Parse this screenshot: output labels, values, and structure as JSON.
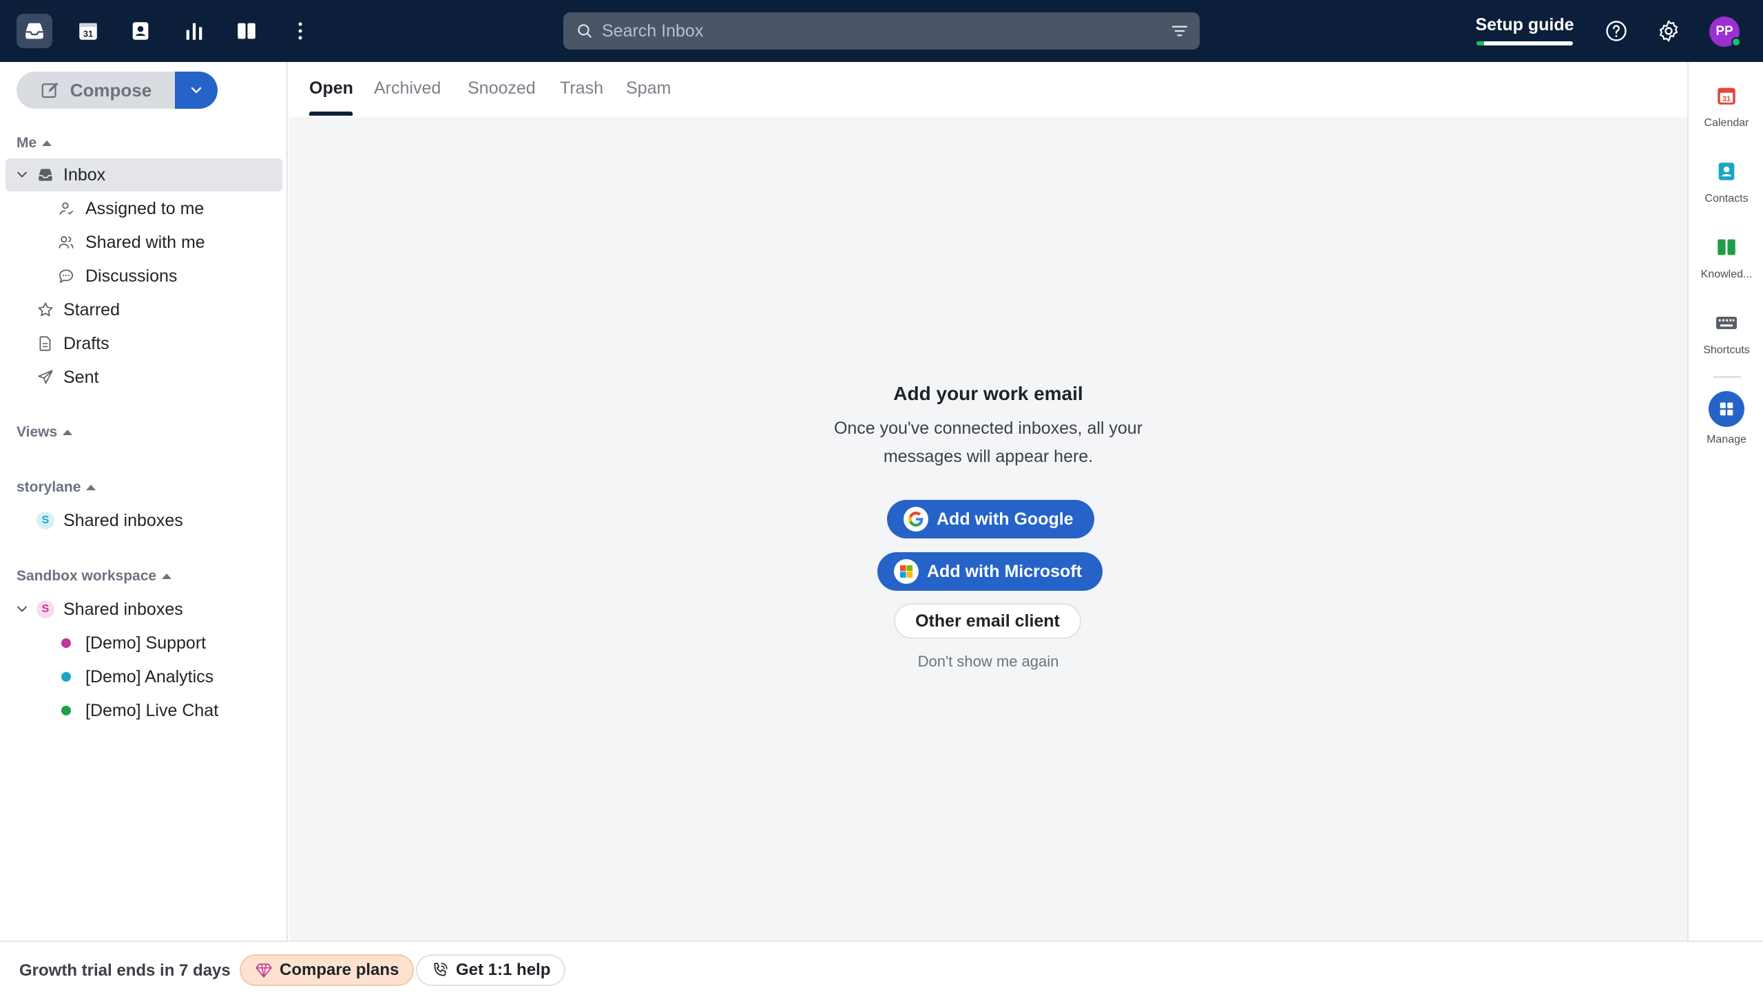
{
  "topbar": {
    "apps": [
      {
        "name": "inbox-app",
        "icon": "inbox-icon",
        "active": true
      },
      {
        "name": "calendar-app",
        "icon": "calendar-icon",
        "label": "31"
      },
      {
        "name": "contacts-app",
        "icon": "contacts-icon"
      },
      {
        "name": "analytics-app",
        "icon": "bar-chart-icon"
      },
      {
        "name": "knowledge-app",
        "icon": "book-icon"
      },
      {
        "name": "more-apps",
        "icon": "more-vertical-icon"
      }
    ],
    "search_placeholder": "Search Inbox",
    "setup_guide_label": "Setup guide",
    "setup_guide_progress": 0.08,
    "avatar_initials": "PP"
  },
  "sidebar": {
    "compose_label": "Compose",
    "me_section": "Me",
    "inbox_label": "Inbox",
    "inbox_children": [
      "Assigned to me",
      "Shared with me",
      "Discussions"
    ],
    "folders": [
      "Starred",
      "Drafts",
      "Sent"
    ],
    "views_section": "Views",
    "storylane_section": "storylane",
    "storylane_shared": {
      "badge": "S",
      "label": "Shared inboxes"
    },
    "sandbox_section": "Sandbox workspace",
    "sandbox_shared": {
      "badge": "S",
      "label": "Shared inboxes"
    },
    "sandbox_inboxes": [
      {
        "label": "[Demo] Support",
        "color": "#c2369a"
      },
      {
        "label": "[Demo] Analytics",
        "color": "#1aa6c2"
      },
      {
        "label": "[Demo] Live Chat",
        "color": "#1f9e47"
      }
    ]
  },
  "tabs": [
    "Open",
    "Archived",
    "Snoozed",
    "Trash",
    "Spam"
  ],
  "empty_state": {
    "title": "Add your work email",
    "description": "Once you've connected inboxes, all your messages will appear here.",
    "google_label": "Add with Google",
    "microsoft_label": "Add with Microsoft",
    "other_label": "Other email client",
    "dismiss_label": "Don't show me again"
  },
  "right_rail": [
    {
      "label": "Calendar",
      "icon": "calendar-icon"
    },
    {
      "label": "Contacts",
      "icon": "contacts-icon"
    },
    {
      "label": "Knowled...",
      "icon": "knowledge-icon"
    },
    {
      "label": "Shortcuts",
      "icon": "keyboard-icon"
    },
    {
      "label": "Manage",
      "icon": "apps-grid-icon"
    }
  ],
  "bottombar": {
    "trial_text": "Growth trial ends in 7 days",
    "compare_label": "Compare plans",
    "help_label": "Get 1:1 help"
  },
  "colors": {
    "topbar_bg": "#0c1f3a",
    "accent_blue": "#2563c9",
    "progress_green": "#1fbf68",
    "avatar_purple": "#9b2fd1"
  }
}
